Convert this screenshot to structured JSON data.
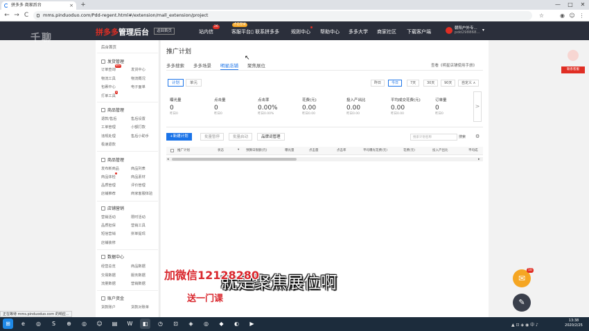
{
  "browser": {
    "tab_title": "拼多多 商家后台",
    "tab_close": "×",
    "new_tab": "+",
    "url": "mms.pinduoduo.com/Pdd-regent.html#/extension/mall_extension/project",
    "nav_back": "←",
    "nav_forward": "→",
    "nav_reload": "C",
    "win_min": "—",
    "win_max": "□",
    "win_close": "✕",
    "status_text": "正在等待 mms.pinduoduo.com 的响应..."
  },
  "watermark": "千聊",
  "header": {
    "brand": "拼多多",
    "brand_sub": "管理后台",
    "home_button": "返回首页",
    "nav": [
      {
        "label": "站内信",
        "badge": "26"
      },
      {
        "label": "客服平台",
        "badge": "点击登录"
      },
      {
        "label": "▯ 联系拼多多",
        "badge": ""
      },
      {
        "label": "规则中心",
        "badge": "•"
      },
      {
        "label": "帮助中心",
        "badge": ""
      },
      {
        "label": "多多大学",
        "badge": ""
      },
      {
        "label": "商家社区",
        "badge": ""
      },
      {
        "label": "下载客户端",
        "badge": ""
      }
    ],
    "user_name": "朝阳户外专...",
    "user_id": "pdd298868...",
    "user_caret": "▾"
  },
  "sidebar": {
    "home": "后台首页",
    "groups": [
      {
        "title": "发货管理",
        "items": [
          "订单查询",
          "发货中心",
          "物流工具",
          "物流概况",
          "包裹中心",
          "电子面单",
          "打单工具"
        ]
      },
      {
        "title": "商品管理",
        "items": [
          "退款/售后",
          "售后设置",
          "工单管理",
          "小额打款",
          "违规处理",
          "售后小助手",
          "极速退款"
        ]
      },
      {
        "title": "商品管理",
        "items": [
          "发布新商品",
          "商品列表",
          "商品体检",
          "商品素材",
          "品质管理",
          "评价管理",
          "店铺推荐",
          "商家客服体验"
        ]
      },
      {
        "title": "店铺营销",
        "items": [
          "营销活动",
          "限时活动",
          "品质担保",
          "营销工具",
          "短信营销",
          "拼单提现",
          "店铺装修"
        ]
      },
      {
        "title": "数据中心",
        "items": [
          "经营总览",
          "商品数据",
          "交易数据",
          "服务数据",
          "流量数据",
          "营销数据"
        ]
      },
      {
        "title": "账户资金",
        "items": [
          "货款账户",
          "货款对账单"
        ]
      }
    ],
    "badges": [
      "99+",
      "4",
      "新"
    ]
  },
  "main": {
    "title": "推广计划",
    "section_tabs": [
      "多多搜索",
      "多多场景",
      "明星店铺",
      "聚焦展位"
    ],
    "active_section": 2,
    "help_link": "查看《明星店铺使用手册》",
    "sub_tabs": [
      "计划",
      "单元"
    ],
    "date_buttons": [
      "昨日",
      "今日",
      "7天",
      "30天",
      "90天",
      "自定义 ∧"
    ],
    "stats": [
      {
        "label": "曝光量",
        "value": "0",
        "prev": "昨日0"
      },
      {
        "label": "点击量",
        "value": "0",
        "prev": "昨日0"
      },
      {
        "label": "点击率",
        "value": "0.00%",
        "prev": "昨日0.00%"
      },
      {
        "label": "花费(元)",
        "value": "0.00",
        "prev": "昨日0.00"
      },
      {
        "label": "投入产出比",
        "value": "0.00",
        "prev": "昨日0.00"
      },
      {
        "label": "平均成交花费(元)",
        "value": "0.00",
        "prev": "昨日0.00"
      },
      {
        "label": "订单量",
        "value": "0",
        "prev": "昨日0"
      }
    ],
    "stats_next": ">",
    "actions": {
      "new_plan": "+新建计划",
      "batch_pause": "批量暂停",
      "batch_start": "批量启动",
      "brand_words": "品牌词管理"
    },
    "search_placeholder": "搜索计划名称",
    "search_button": "搜索",
    "settings_icon": "⚙",
    "table_headers": [
      "推广计划",
      "状态",
      "全选",
      "预算日限额(元)",
      "曝光量",
      "点击量",
      "点击率",
      "平均曝光花费(元)",
      "花费(元)",
      "投入产出比",
      "平均成"
    ],
    "scroll_left": "◂",
    "scroll_right": "▸"
  },
  "floating": {
    "promo_label": "联系客服",
    "mail_badge": "10",
    "mail_icon": "✉",
    "edit_icon": "✎"
  },
  "captions": {
    "red_line1": "加微信12128280",
    "subtitle": "就是聚焦展位啊",
    "red_line2": "送一门课"
  },
  "taskbar": {
    "time": "13:38",
    "date": "2020/2/25",
    "apps": [
      "⊞",
      "e",
      "◎",
      "S",
      "⊕",
      "◎",
      "☺",
      "▤",
      "W",
      "◧",
      "◷",
      "⊡",
      "◈",
      "◎",
      "◆",
      "◐",
      "▶"
    ],
    "tray": "▲ ⊡ ◈ ◉ 中 ♪"
  }
}
